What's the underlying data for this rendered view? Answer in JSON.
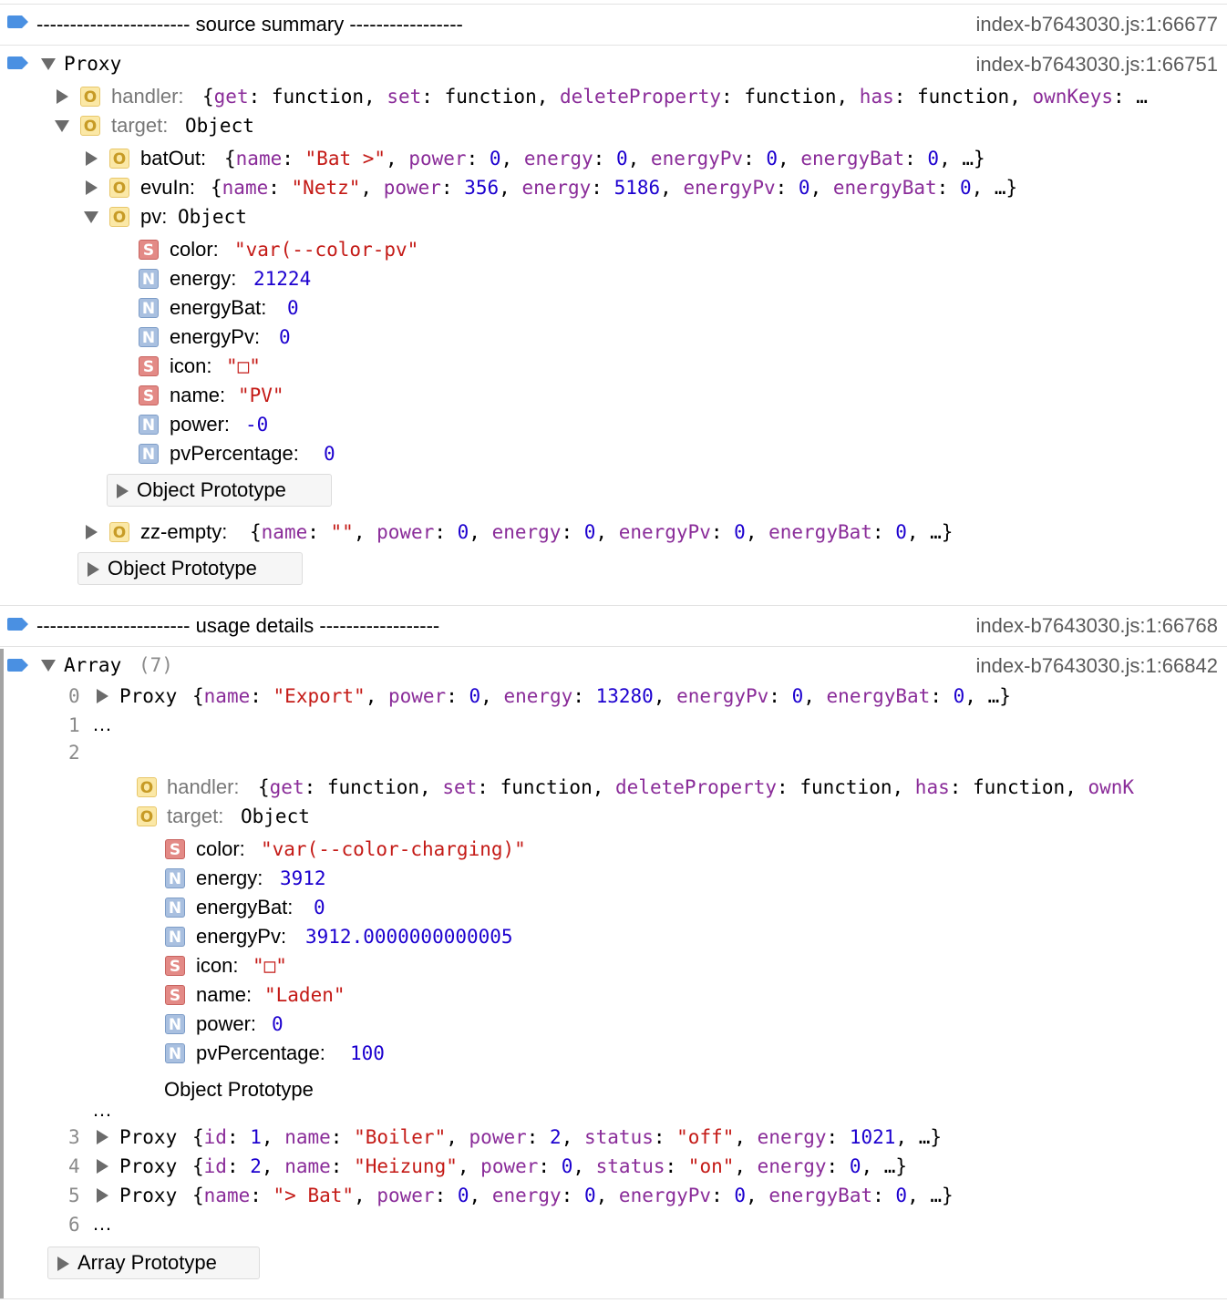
{
  "entries": [
    {
      "label": "----------------------- source summary -----------------",
      "source": "index-b7643030.js:1:66677"
    },
    {
      "label": "Proxy",
      "source": "index-b7643030.js:1:66751"
    },
    {
      "label": "----------------------- usage details ------------------",
      "source": "index-b7643030.js:1:66768"
    },
    {
      "label": "Array",
      "count": "(7)",
      "source": "index-b7643030.js:1:66842"
    }
  ],
  "proxy1": {
    "handler_key": "handler:",
    "target_key": "target:",
    "target_type": "Object",
    "batOut_key": "batOut:",
    "evuIn_key": "evuIn:",
    "pv_key": "pv:",
    "pv_type": "Object",
    "pv_props": [
      {
        "badge": "S",
        "key": "color:",
        "value": "\"var(--color-pv\""
      },
      {
        "badge": "N",
        "key": "energy:",
        "value": "21224"
      },
      {
        "badge": "N",
        "key": "energyBat:",
        "value": "0"
      },
      {
        "badge": "N",
        "key": "energyPv:",
        "value": "0"
      },
      {
        "badge": "S",
        "key": "icon:",
        "value": "\"□\""
      },
      {
        "badge": "S",
        "key": "name:",
        "value": "\"PV\""
      },
      {
        "badge": "N",
        "key": "power:",
        "value": "-0"
      },
      {
        "badge": "N",
        "key": "pvPercentage:",
        "value": "0"
      }
    ],
    "zz_key": "zz-empty:",
    "object_prototype": "Object Prototype"
  },
  "array": {
    "proxy_word": "Proxy",
    "ellipsis": "…",
    "index_labels": [
      "0",
      "1",
      "2",
      "3",
      "4",
      "5",
      "6"
    ],
    "item2": {
      "handler_key": "handler:",
      "target_key": "target:",
      "target_type": "Object",
      "props": [
        {
          "badge": "S",
          "key": "color:",
          "value": "\"var(--color-charging)\""
        },
        {
          "badge": "N",
          "key": "energy:",
          "value": "3912"
        },
        {
          "badge": "N",
          "key": "energyBat:",
          "value": "0"
        },
        {
          "badge": "N",
          "key": "energyPv:",
          "value": "3912.0000000000005"
        },
        {
          "badge": "S",
          "key": "icon:",
          "value": "\"□\""
        },
        {
          "badge": "S",
          "key": "name:",
          "value": "\"Laden\""
        },
        {
          "badge": "N",
          "key": "power:",
          "value": "0"
        },
        {
          "badge": "N",
          "key": "pvPercentage:",
          "value": "100"
        }
      ],
      "object_prototype": "Object Prototype"
    },
    "array_prototype": "Array Prototype"
  },
  "previews": {
    "handler1": [
      [
        "{",
        ""
      ],
      [
        "get",
        "k"
      ],
      [
        ": ",
        ""
      ],
      [
        "function",
        ""
      ],
      [
        ", ",
        ""
      ],
      [
        "set",
        "k"
      ],
      [
        ": ",
        ""
      ],
      [
        "function",
        ""
      ],
      [
        ", ",
        ""
      ],
      [
        "deleteProperty",
        "k"
      ],
      [
        ": ",
        ""
      ],
      [
        "function",
        ""
      ],
      [
        ", ",
        ""
      ],
      [
        "has",
        "k"
      ],
      [
        ": ",
        ""
      ],
      [
        "function",
        ""
      ],
      [
        ", ",
        ""
      ],
      [
        "ownKeys",
        "k"
      ],
      [
        ": …",
        ""
      ]
    ],
    "batOut": [
      [
        "{",
        ""
      ],
      [
        "name",
        "k"
      ],
      [
        ": ",
        ""
      ],
      [
        "\"Bat >\"",
        "s"
      ],
      [
        ", ",
        ""
      ],
      [
        "power",
        "k"
      ],
      [
        ": ",
        ""
      ],
      [
        "0",
        "n"
      ],
      [
        ", ",
        ""
      ],
      [
        "energy",
        "k"
      ],
      [
        ": ",
        ""
      ],
      [
        "0",
        "n"
      ],
      [
        ", ",
        ""
      ],
      [
        "energyPv",
        "k"
      ],
      [
        ": ",
        ""
      ],
      [
        "0",
        "n"
      ],
      [
        ", ",
        ""
      ],
      [
        "energyBat",
        "k"
      ],
      [
        ": ",
        ""
      ],
      [
        "0",
        "n"
      ],
      [
        ", …}",
        ""
      ]
    ],
    "evuIn": [
      [
        "{",
        ""
      ],
      [
        "name",
        "k"
      ],
      [
        ": ",
        ""
      ],
      [
        "\"Netz\"",
        "s"
      ],
      [
        ", ",
        ""
      ],
      [
        "power",
        "k"
      ],
      [
        ": ",
        ""
      ],
      [
        "356",
        "n"
      ],
      [
        ", ",
        ""
      ],
      [
        "energy",
        "k"
      ],
      [
        ": ",
        ""
      ],
      [
        "5186",
        "n"
      ],
      [
        ", ",
        ""
      ],
      [
        "energyPv",
        "k"
      ],
      [
        ": ",
        ""
      ],
      [
        "0",
        "n"
      ],
      [
        ", ",
        ""
      ],
      [
        "energyBat",
        "k"
      ],
      [
        ": ",
        ""
      ],
      [
        "0",
        "n"
      ],
      [
        ", …}",
        ""
      ]
    ],
    "zz": [
      [
        "{",
        ""
      ],
      [
        "name",
        "k"
      ],
      [
        ": ",
        ""
      ],
      [
        "\"\"",
        "s"
      ],
      [
        ", ",
        ""
      ],
      [
        "power",
        "k"
      ],
      [
        ": ",
        ""
      ],
      [
        "0",
        "n"
      ],
      [
        ", ",
        ""
      ],
      [
        "energy",
        "k"
      ],
      [
        ": ",
        ""
      ],
      [
        "0",
        "n"
      ],
      [
        ", ",
        ""
      ],
      [
        "energyPv",
        "k"
      ],
      [
        ": ",
        ""
      ],
      [
        "0",
        "n"
      ],
      [
        ", ",
        ""
      ],
      [
        "energyBat",
        "k"
      ],
      [
        ": ",
        ""
      ],
      [
        "0",
        "n"
      ],
      [
        ", …}",
        ""
      ]
    ],
    "item0": [
      [
        "{",
        ""
      ],
      [
        "name",
        "k"
      ],
      [
        ": ",
        ""
      ],
      [
        "\"Export\"",
        "s"
      ],
      [
        ", ",
        ""
      ],
      [
        "power",
        "k"
      ],
      [
        ": ",
        ""
      ],
      [
        "0",
        "n"
      ],
      [
        ", ",
        ""
      ],
      [
        "energy",
        "k"
      ],
      [
        ": ",
        ""
      ],
      [
        "13280",
        "n"
      ],
      [
        ", ",
        ""
      ],
      [
        "energyPv",
        "k"
      ],
      [
        ": ",
        ""
      ],
      [
        "0",
        "n"
      ],
      [
        ", ",
        ""
      ],
      [
        "energyBat",
        "k"
      ],
      [
        ": ",
        ""
      ],
      [
        "0",
        "n"
      ],
      [
        ", …}",
        ""
      ]
    ],
    "handler2": [
      [
        "{",
        ""
      ],
      [
        "get",
        "k"
      ],
      [
        ": ",
        ""
      ],
      [
        "function",
        ""
      ],
      [
        ", ",
        ""
      ],
      [
        "set",
        "k"
      ],
      [
        ": ",
        ""
      ],
      [
        "function",
        ""
      ],
      [
        ", ",
        ""
      ],
      [
        "deleteProperty",
        "k"
      ],
      [
        ": ",
        ""
      ],
      [
        "function",
        ""
      ],
      [
        ", ",
        ""
      ],
      [
        "has",
        "k"
      ],
      [
        ": ",
        ""
      ],
      [
        "function",
        ""
      ],
      [
        ", ",
        ""
      ],
      [
        "ownK",
        "k"
      ]
    ],
    "item3": [
      [
        "{",
        ""
      ],
      [
        "id",
        "k"
      ],
      [
        ": ",
        ""
      ],
      [
        "1",
        "n"
      ],
      [
        ", ",
        ""
      ],
      [
        "name",
        "k"
      ],
      [
        ": ",
        ""
      ],
      [
        "\"Boiler\"",
        "s"
      ],
      [
        ", ",
        ""
      ],
      [
        "power",
        "k"
      ],
      [
        ": ",
        ""
      ],
      [
        "2",
        "n"
      ],
      [
        ", ",
        ""
      ],
      [
        "status",
        "k"
      ],
      [
        ": ",
        ""
      ],
      [
        "\"off\"",
        "s"
      ],
      [
        ", ",
        ""
      ],
      [
        "energy",
        "k"
      ],
      [
        ": ",
        ""
      ],
      [
        "1021",
        "n"
      ],
      [
        ", …}",
        ""
      ]
    ],
    "item4": [
      [
        "{",
        ""
      ],
      [
        "id",
        "k"
      ],
      [
        ": ",
        ""
      ],
      [
        "2",
        "n"
      ],
      [
        ", ",
        ""
      ],
      [
        "name",
        "k"
      ],
      [
        ": ",
        ""
      ],
      [
        "\"Heizung\"",
        "s"
      ],
      [
        ", ",
        ""
      ],
      [
        "power",
        "k"
      ],
      [
        ": ",
        ""
      ],
      [
        "0",
        "n"
      ],
      [
        ", ",
        ""
      ],
      [
        "status",
        "k"
      ],
      [
        ": ",
        ""
      ],
      [
        "\"on\"",
        "s"
      ],
      [
        ", ",
        ""
      ],
      [
        "energy",
        "k"
      ],
      [
        ": ",
        ""
      ],
      [
        "0",
        "n"
      ],
      [
        ", …}",
        ""
      ]
    ],
    "item5": [
      [
        "{",
        ""
      ],
      [
        "name",
        "k"
      ],
      [
        ": ",
        ""
      ],
      [
        "\"> Bat\"",
        "s"
      ],
      [
        ", ",
        ""
      ],
      [
        "power",
        "k"
      ],
      [
        ": ",
        ""
      ],
      [
        "0",
        "n"
      ],
      [
        ", ",
        ""
      ],
      [
        "energy",
        "k"
      ],
      [
        ": ",
        ""
      ],
      [
        "0",
        "n"
      ],
      [
        ", ",
        ""
      ],
      [
        "energyPv",
        "k"
      ],
      [
        ": ",
        ""
      ],
      [
        "0",
        "n"
      ],
      [
        ", ",
        ""
      ],
      [
        "energyBat",
        "k"
      ],
      [
        ": ",
        ""
      ],
      [
        "0",
        "n"
      ],
      [
        ", …}",
        ""
      ]
    ]
  },
  "colors": {
    "property_key": "#8a2c99",
    "string": "#c41a16",
    "number": "#1c00cf",
    "log_icon": "#4a90e2"
  }
}
